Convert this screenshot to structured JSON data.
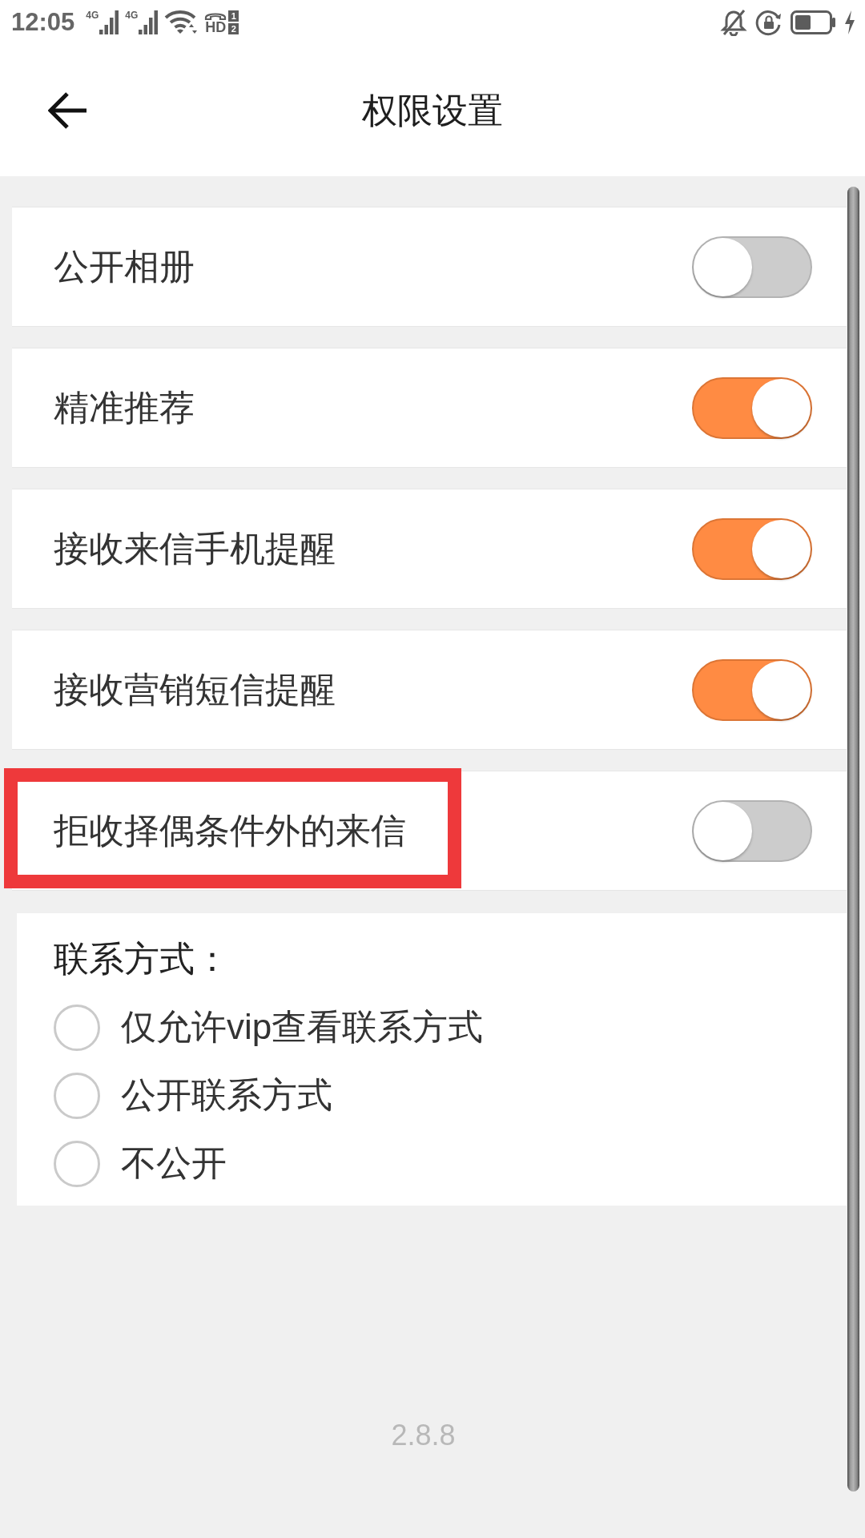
{
  "status_bar": {
    "time": "12:05",
    "networks": [
      {
        "label": "4G"
      },
      {
        "label": "4G"
      }
    ],
    "hd": {
      "label": "HD",
      "sims": [
        "1",
        "2"
      ]
    }
  },
  "header": {
    "title": "权限设置"
  },
  "toggles": [
    {
      "label": "公开相册",
      "on": false,
      "highlighted": false
    },
    {
      "label": "精准推荐",
      "on": true,
      "highlighted": false
    },
    {
      "label": "接收来信手机提醒",
      "on": true,
      "highlighted": false
    },
    {
      "label": "接收营销短信提醒",
      "on": true,
      "highlighted": false
    },
    {
      "label": "拒收择偶条件外的来信",
      "on": false,
      "highlighted": true
    }
  ],
  "contact": {
    "heading": "联系方式：",
    "options": [
      {
        "label": "仅允许vip查看联系方式",
        "selected": false
      },
      {
        "label": "公开联系方式",
        "selected": false
      },
      {
        "label": "不公开",
        "selected": false
      }
    ]
  },
  "version": "2.8.8"
}
